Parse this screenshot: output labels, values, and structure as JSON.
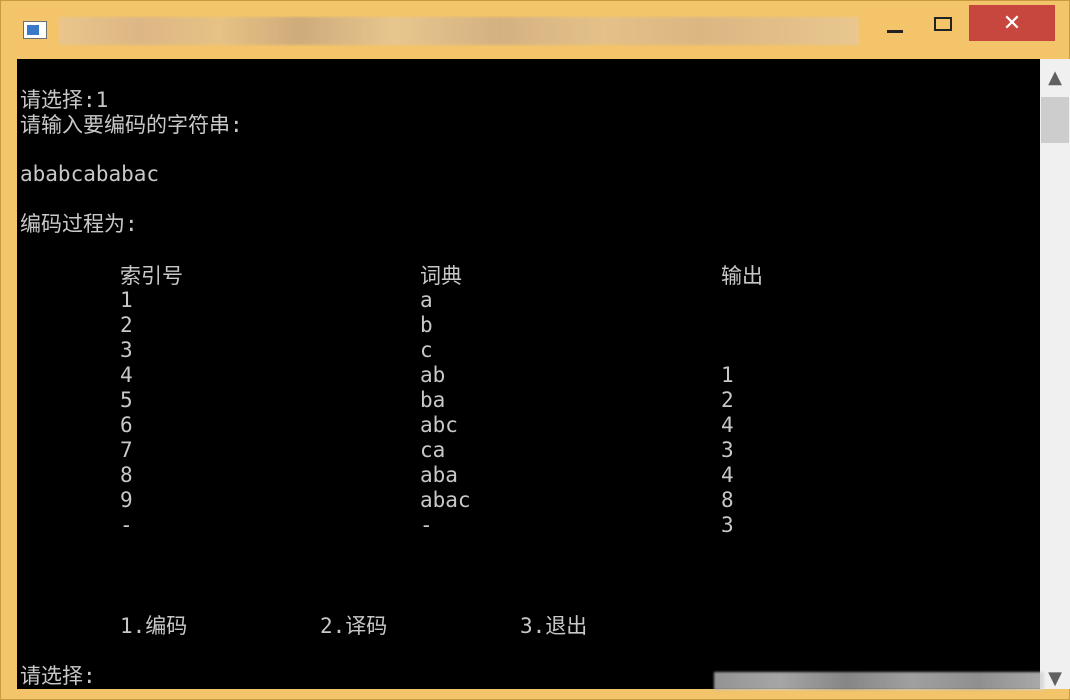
{
  "window": {
    "title": "",
    "close_label": "✕"
  },
  "console": {
    "prompt_1": "请选择:1",
    "input_prompt": "请输入要编码的字符串:",
    "input_string": "ababcababac",
    "process_label": "编码过程为:",
    "columns": [
      "索引号",
      "词典",
      "输出"
    ],
    "rows": [
      [
        "1",
        "a",
        ""
      ],
      [
        "2",
        "b",
        ""
      ],
      [
        "3",
        "c",
        ""
      ],
      [
        "4",
        "ab",
        "1"
      ],
      [
        "5",
        "ba",
        "2"
      ],
      [
        "6",
        "abc",
        "4"
      ],
      [
        "7",
        "ca",
        "3"
      ],
      [
        "8",
        "aba",
        "4"
      ],
      [
        "9",
        "abac",
        "8"
      ],
      [
        "-",
        "-",
        "3"
      ]
    ],
    "menu": [
      "1.编码",
      "2.译码",
      "3.退出"
    ],
    "prompt_2": "请选择:"
  },
  "scrollbar": {
    "up_icon": "chevron-up-icon",
    "down_icon": "chevron-down-icon"
  }
}
